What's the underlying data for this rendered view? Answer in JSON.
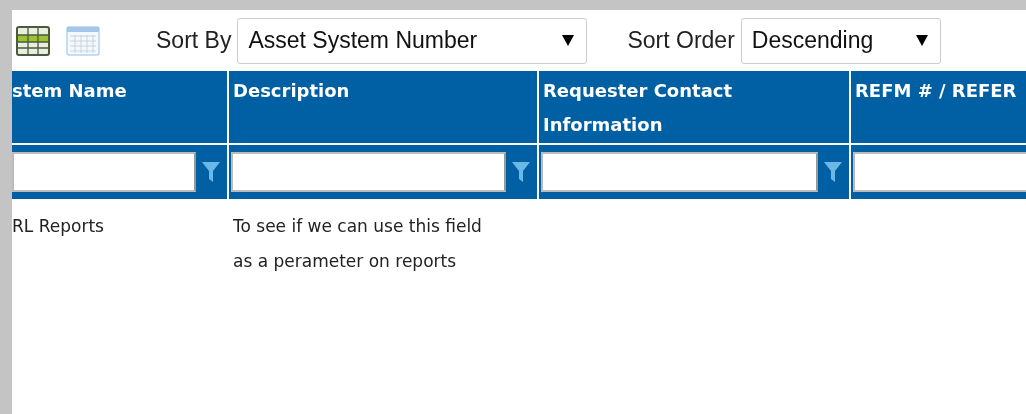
{
  "toolbar": {
    "view_toggles": [
      {
        "kind": "grid",
        "selected": true
      },
      {
        "kind": "table",
        "selected": false
      }
    ],
    "sort_by": {
      "label": "Sort By",
      "value": "Asset System Number"
    },
    "sort_order": {
      "label": "Sort Order",
      "value": "Descending"
    }
  },
  "table": {
    "columns": [
      {
        "header": "stem Name",
        "filter_icon": true
      },
      {
        "header": "Description",
        "filter_icon": true
      },
      {
        "header": "Requester Contact Information",
        "filter_icon": true
      },
      {
        "header": "REFM # / REFER",
        "filter_icon": false
      }
    ],
    "rows": [
      {
        "cells": [
          "RL Reports",
          "To see if we can use this field as a perameter on reports"
        ]
      }
    ]
  }
}
